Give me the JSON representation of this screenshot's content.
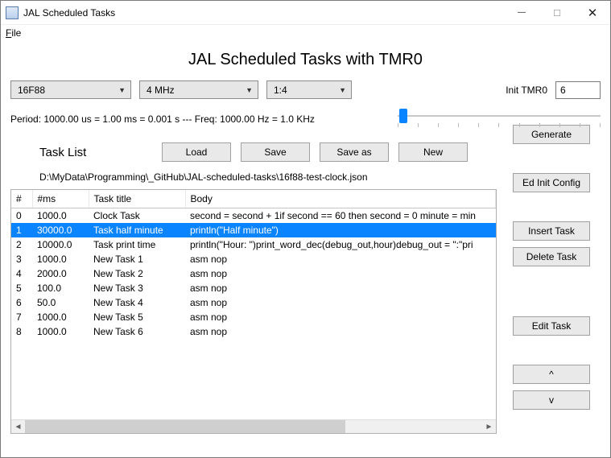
{
  "window": {
    "title": "JAL Scheduled Tasks"
  },
  "menu": {
    "file": "File",
    "file_accel": "F"
  },
  "heading": "JAL Scheduled Tasks with TMR0",
  "combos": {
    "mcu": "16F88",
    "freq": "4 MHz",
    "prescale": "1:4"
  },
  "tmr": {
    "label": "Init TMR0",
    "value": "6"
  },
  "period_text": "Period: 1000.00 us = 1.00 ms = 0.001 s --- Freq: 1000.00 Hz = 1.0 KHz",
  "tasklist": {
    "label": "Task List",
    "buttons": {
      "load": "Load",
      "save": "Save",
      "saveas": "Save as",
      "new": "New"
    }
  },
  "filepath": "D:\\MyData\\Programming\\_GitHub\\JAL-scheduled-tasks\\16f88-test-clock.json",
  "table": {
    "headers": {
      "idx": "#",
      "ms": "#ms",
      "title": "Task title",
      "body": "Body"
    },
    "rows": [
      {
        "idx": "0",
        "ms": "1000.0",
        "title": "Clock Task",
        "body": "second = second + 1if second == 60 then  second = 0  minute = min"
      },
      {
        "idx": "1",
        "ms": "30000.0",
        "title": "Task half minute",
        "body": "println(\"Half minute\")"
      },
      {
        "idx": "2",
        "ms": "10000.0",
        "title": "Task print time",
        "body": "println(\"Hour: \")print_word_dec(debug_out,hour)debug_out = \":\"pri"
      },
      {
        "idx": "3",
        "ms": "1000.0",
        "title": "New Task 1",
        "body": "asm nop"
      },
      {
        "idx": "4",
        "ms": "2000.0",
        "title": "New Task 2",
        "body": "asm nop"
      },
      {
        "idx": "5",
        "ms": "100.0",
        "title": "New Task 3",
        "body": "asm nop"
      },
      {
        "idx": "6",
        "ms": "50.0",
        "title": "New Task 4",
        "body": "asm nop"
      },
      {
        "idx": "7",
        "ms": "1000.0",
        "title": "New Task 5",
        "body": "asm nop"
      },
      {
        "idx": "8",
        "ms": "1000.0",
        "title": "New Task 6",
        "body": "asm nop"
      }
    ],
    "selected_index": 1
  },
  "side_buttons": {
    "generate": "Generate",
    "ed_init": "Ed Init Config",
    "insert": "Insert Task",
    "delete": "Delete Task",
    "edit": "Edit Task",
    "up": "^",
    "down": "v"
  }
}
